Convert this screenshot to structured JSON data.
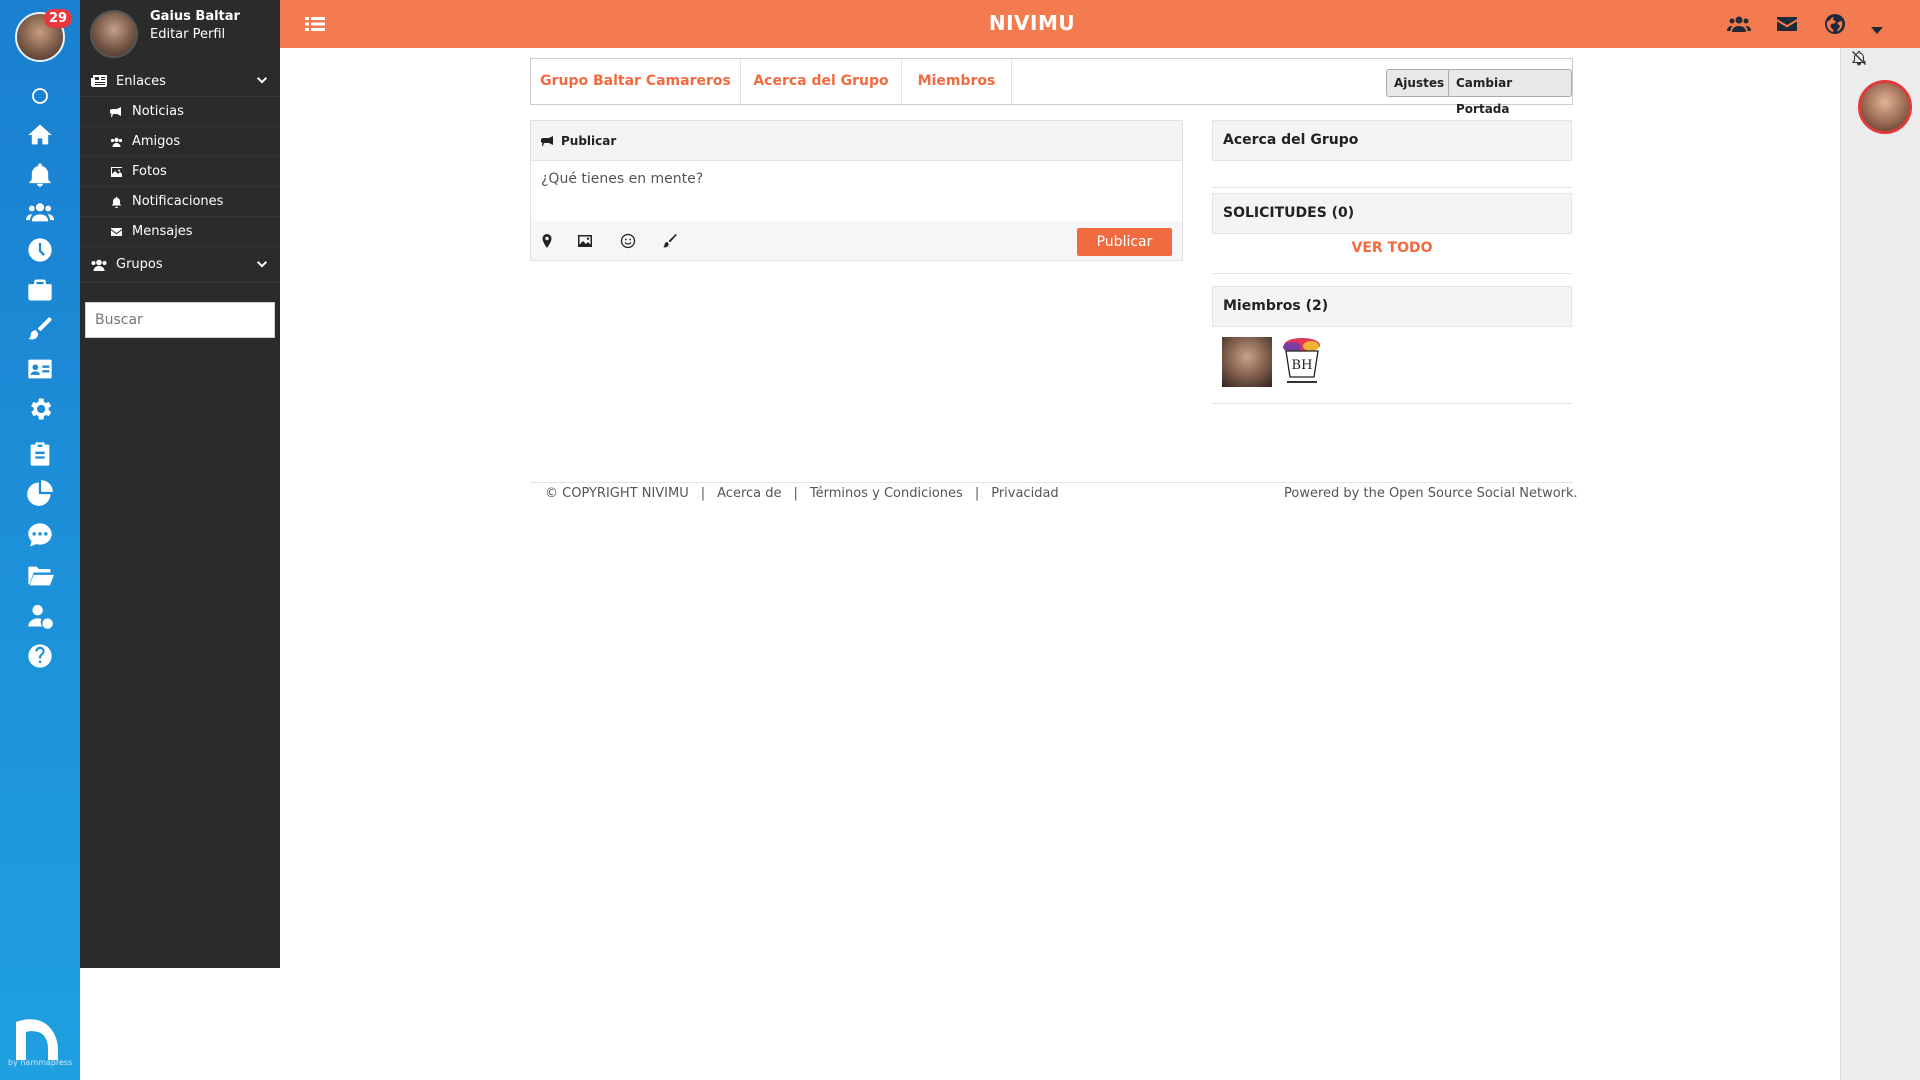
{
  "rail": {
    "badge_count": "29",
    "icons": [
      "circle-icon",
      "home-icon",
      "bell-icon",
      "users-icon",
      "clock-icon",
      "briefcase-icon",
      "brush-icon",
      "address-card-icon",
      "gear-icon",
      "clipboard-icon",
      "pie-chart-icon",
      "chat-icon",
      "folder-icon",
      "user-dollar-icon",
      "help-icon"
    ],
    "footer_by": "by nammapress"
  },
  "sidebar": {
    "user_name": "Gaius Baltar",
    "edit_profile": "Editar Perfil",
    "links_label": "Enlaces",
    "items": [
      {
        "label": "Noticias",
        "icon": "bullhorn-icon"
      },
      {
        "label": "Amigos",
        "icon": "users-icon"
      },
      {
        "label": "Fotos",
        "icon": "image-icon"
      },
      {
        "label": "Notificaciones",
        "icon": "bell-icon"
      },
      {
        "label": "Mensajes",
        "icon": "envelope-icon"
      }
    ],
    "groups_label": "Grupos",
    "search_placeholder": "Buscar"
  },
  "topbar": {
    "title": "NIVIMU",
    "color": "#f47a4f"
  },
  "group": {
    "tabs": [
      "Grupo Baltar Camareros",
      "Acerca del Grupo",
      "Miembros"
    ],
    "settings_button": "Ajustes",
    "cover_button": "Cambiar Portada"
  },
  "post": {
    "header": "Publicar",
    "placeholder": "¿Qué tienes en mente?",
    "publish_button": "Publicar"
  },
  "widgets": {
    "about_title": "Acerca del Grupo",
    "requests_title": "SOLICITUDES (0)",
    "see_all": "VER TODO",
    "members_title": "Miembros (2)",
    "member_logo_text": "Busy Hall Design"
  },
  "footer": {
    "copyright": "© COPYRIGHT NIVIMU",
    "links": [
      "Acerca de",
      "Términos y Condiciones",
      "Privacidad"
    ],
    "powered": "Powered by the Open Source Social Network."
  },
  "accent_color": "#f26a3f"
}
